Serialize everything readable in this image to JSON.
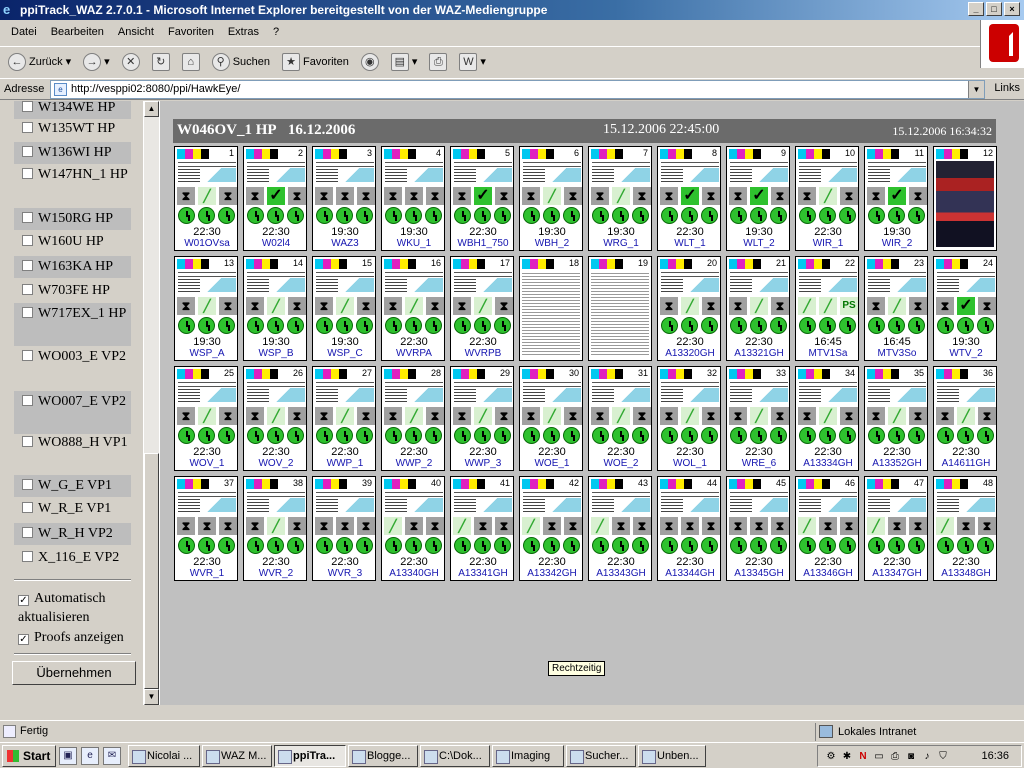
{
  "window": {
    "title": "ppiTrack_WAZ 2.7.0.1 - Microsoft Internet Explorer bereitgestellt von der WAZ-Mediengruppe"
  },
  "menu": [
    "Datei",
    "Bearbeiten",
    "Ansicht",
    "Favoriten",
    "Extras",
    "?"
  ],
  "toolbar": {
    "back": "Zurück",
    "search": "Suchen",
    "favorites": "Favoriten"
  },
  "address": {
    "label": "Adresse",
    "url": "http://vesppi02:8080/ppi/HawkEye/",
    "links": "Links"
  },
  "sidebar": {
    "items": [
      "W134WE HP",
      "W135WT HP",
      "W136WI HP",
      "W147HN_1 HP",
      "W150RG HP",
      "W160U HP",
      "W163KA HP",
      "W703FE HP",
      "W717EX_1 HP",
      "WO003_E VP2",
      "WO007_E VP2",
      "WO888_H VP1",
      "W_G_E VP1",
      "W_R_E VP1",
      "W_R_H VP2",
      "X_116_E VP2"
    ],
    "auto_label": "Automatisch aktualisieren",
    "proofs_label": "Proofs anzeigen",
    "apply_button": "Übernehmen"
  },
  "header": {
    "edition": "W046OV_1 HP",
    "edition_date": "16.12.2006",
    "deadline": "15.12.2006 22:45:00",
    "updated": "15.12.2006 16:34:32"
  },
  "colors": {
    "cyan": "#00c8f0",
    "magenta": "#e020c0",
    "yellow": "#ffee00",
    "black": "#000000",
    "green": "#2ec12e",
    "link": "#1515b0"
  },
  "tiles": [
    {
      "n": "1",
      "time": "22:30",
      "name": "W01OVsa",
      "st": "hlh"
    },
    {
      "n": "2",
      "time": "22:30",
      "name": "W02l4",
      "st": "hkh"
    },
    {
      "n": "3",
      "time": "19:30",
      "name": "WAZ3",
      "st": "hhh"
    },
    {
      "n": "4",
      "time": "19:30",
      "name": "WKU_1",
      "st": "hhh"
    },
    {
      "n": "5",
      "time": "22:30",
      "name": "WBH1_750",
      "st": "hkh"
    },
    {
      "n": "6",
      "time": "19:30",
      "name": "WBH_2",
      "st": "hlh"
    },
    {
      "n": "7",
      "time": "19:30",
      "name": "WRG_1",
      "st": "hlh"
    },
    {
      "n": "8",
      "time": "22:30",
      "name": "WLT_1",
      "st": "hkh"
    },
    {
      "n": "9",
      "time": "19:30",
      "name": "WLT_2",
      "st": "hkh"
    },
    {
      "n": "10",
      "time": "22:30",
      "name": "WIR_1",
      "st": "hlh"
    },
    {
      "n": "11",
      "time": "19:30",
      "name": "WIR_2",
      "st": "hkh"
    },
    {
      "n": "12",
      "time": "",
      "name": "",
      "st": "img"
    },
    {
      "n": "13",
      "time": "19:30",
      "name": "WSP_A",
      "st": "hlh"
    },
    {
      "n": "14",
      "time": "19:30",
      "name": "WSP_B",
      "st": "hlh"
    },
    {
      "n": "15",
      "time": "19:30",
      "name": "WSP_C",
      "st": "hlh"
    },
    {
      "n": "16",
      "time": "22:30",
      "name": "WVRPA",
      "st": "hlh"
    },
    {
      "n": "17",
      "time": "22:30",
      "name": "WVRPB",
      "st": "hlh"
    },
    {
      "n": "18",
      "time": "",
      "name": "",
      "st": "img"
    },
    {
      "n": "19",
      "time": "",
      "name": "",
      "st": "img"
    },
    {
      "n": "20",
      "time": "22:30",
      "name": "A13320GH",
      "st": "hlh"
    },
    {
      "n": "21",
      "time": "22:30",
      "name": "A13321GH",
      "st": "hlh"
    },
    {
      "n": "22",
      "time": "16:45",
      "name": "MTV1Sa",
      "st": "llp"
    },
    {
      "n": "23",
      "time": "16:45",
      "name": "MTV3So",
      "st": "hlh"
    },
    {
      "n": "24",
      "time": "19:30",
      "name": "WTV_2",
      "st": "hkh"
    },
    {
      "n": "25",
      "time": "22:30",
      "name": "WOV_1",
      "st": "hlh"
    },
    {
      "n": "26",
      "time": "22:30",
      "name": "WOV_2",
      "st": "hlh"
    },
    {
      "n": "27",
      "time": "22:30",
      "name": "WWP_1",
      "st": "hlh"
    },
    {
      "n": "28",
      "time": "22:30",
      "name": "WWP_2",
      "st": "hlh"
    },
    {
      "n": "29",
      "time": "22:30",
      "name": "WWP_3",
      "st": "hlh"
    },
    {
      "n": "30",
      "time": "22:30",
      "name": "WOE_1",
      "st": "hlh"
    },
    {
      "n": "31",
      "time": "22:30",
      "name": "WOE_2",
      "st": "hlh"
    },
    {
      "n": "32",
      "time": "22:30",
      "name": "WOL_1",
      "st": "hlh"
    },
    {
      "n": "33",
      "time": "22:30",
      "name": "WRE_6",
      "st": "hlh"
    },
    {
      "n": "34",
      "time": "22:30",
      "name": "A13334GH",
      "st": "hlh"
    },
    {
      "n": "35",
      "time": "22:30",
      "name": "A13352GH",
      "st": "hlh"
    },
    {
      "n": "36",
      "time": "22:30",
      "name": "A14611GH",
      "st": "hlh"
    },
    {
      "n": "37",
      "time": "22:30",
      "name": "WVR_1",
      "st": "hhh"
    },
    {
      "n": "38",
      "time": "22:30",
      "name": "WVR_2",
      "st": "hlh"
    },
    {
      "n": "39",
      "time": "22:30",
      "name": "WVR_3",
      "st": "hhh"
    },
    {
      "n": "40",
      "time": "22:30",
      "name": "A13340GH",
      "st": "lhh"
    },
    {
      "n": "41",
      "time": "22:30",
      "name": "A13341GH",
      "st": "lhh"
    },
    {
      "n": "42",
      "time": "22:30",
      "name": "A13342GH",
      "st": "lhh"
    },
    {
      "n": "43",
      "time": "22:30",
      "name": "A13343GH",
      "st": "lhh"
    },
    {
      "n": "44",
      "time": "22:30",
      "name": "A13344GH",
      "st": "hhh"
    },
    {
      "n": "45",
      "time": "22:30",
      "name": "A13345GH",
      "st": "hhh"
    },
    {
      "n": "46",
      "time": "22:30",
      "name": "A13346GH",
      "st": "lhh"
    },
    {
      "n": "47",
      "time": "22:30",
      "name": "A13347GH",
      "st": "lhh"
    },
    {
      "n": "48",
      "time": "22:30",
      "name": "A13348GH",
      "st": "lhh"
    }
  ],
  "tooltip": "Rechtzeitig",
  "status": {
    "text": "Fertig",
    "zone": "Lokales Intranet"
  },
  "taskbar": {
    "start": "Start",
    "tasks": [
      "Nicolai ...",
      "WAZ M...",
      "ppiTra...",
      "Blogge...",
      "C:\\Dok...",
      "Imaging",
      "Sucher...",
      "Unben..."
    ],
    "clock": "16:36"
  }
}
